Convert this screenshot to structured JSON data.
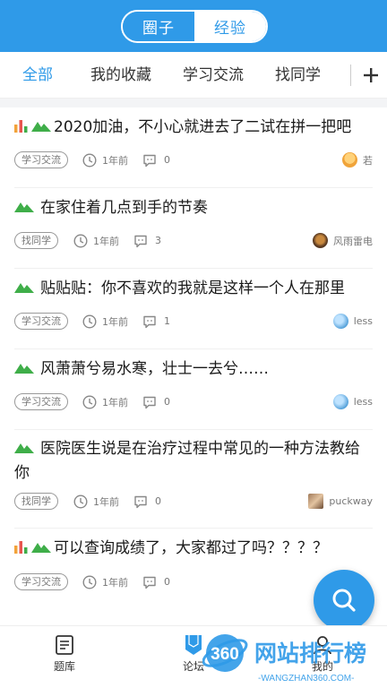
{
  "header": {
    "segments": [
      {
        "label": "圈子",
        "active": true
      },
      {
        "label": "经验",
        "active": false
      }
    ]
  },
  "tabs": [
    {
      "label": "全部",
      "active": true
    },
    {
      "label": "我的收藏"
    },
    {
      "label": "学习交流"
    },
    {
      "label": "找同学"
    }
  ],
  "posts": [
    {
      "title": "2020加油，不小心就进去了二试在拼一把吧",
      "tag": "学习交流",
      "time": "1年前",
      "comments": "0",
      "author": "若",
      "icons": [
        "bar-chart-icon",
        "mountain-icon"
      ]
    },
    {
      "title": "在家住着几点到手的节奏",
      "tag": "找同学",
      "time": "1年前",
      "comments": "3",
      "author": "风雨雷电",
      "icons": [
        "mountain-icon"
      ]
    },
    {
      "title": "贴贴贴：你不喜欢的我就是这样一个人在那里",
      "tag": "学习交流",
      "time": "1年前",
      "comments": "1",
      "author": "less",
      "icons": [
        "mountain-icon"
      ]
    },
    {
      "title": "风萧萧兮易水寒，壮士一去兮……",
      "tag": "学习交流",
      "time": "1年前",
      "comments": "0",
      "author": "less",
      "icons": [
        "mountain-icon"
      ]
    },
    {
      "title": "医院医生说是在治疗过程中常见的一种方法教给你",
      "tag": "找同学",
      "time": "1年前",
      "comments": "0",
      "author": "puckway",
      "icons": [
        "mountain-icon"
      ]
    },
    {
      "title": "可以查询成绩了，大家都过了吗？？？？",
      "tag": "学习交流",
      "time": "1年前",
      "comments": "0",
      "author": "",
      "icons": [
        "bar-chart-icon",
        "mountain-icon"
      ]
    }
  ],
  "bottom_nav": [
    {
      "label": "题库",
      "icon": "question-bank-icon"
    },
    {
      "label": "论坛",
      "icon": "forum-icon",
      "active": true
    },
    {
      "label": "我的",
      "icon": "profile-icon"
    }
  ],
  "watermark": {
    "logo": "360",
    "title": "网站排行榜",
    "url": "-WANGZHAN360.COM-"
  },
  "colors": {
    "accent": "#2f9ae8",
    "green_icon": "#3fae49",
    "bar_orange": "#f2a23a",
    "bar_red": "#e8554e"
  }
}
